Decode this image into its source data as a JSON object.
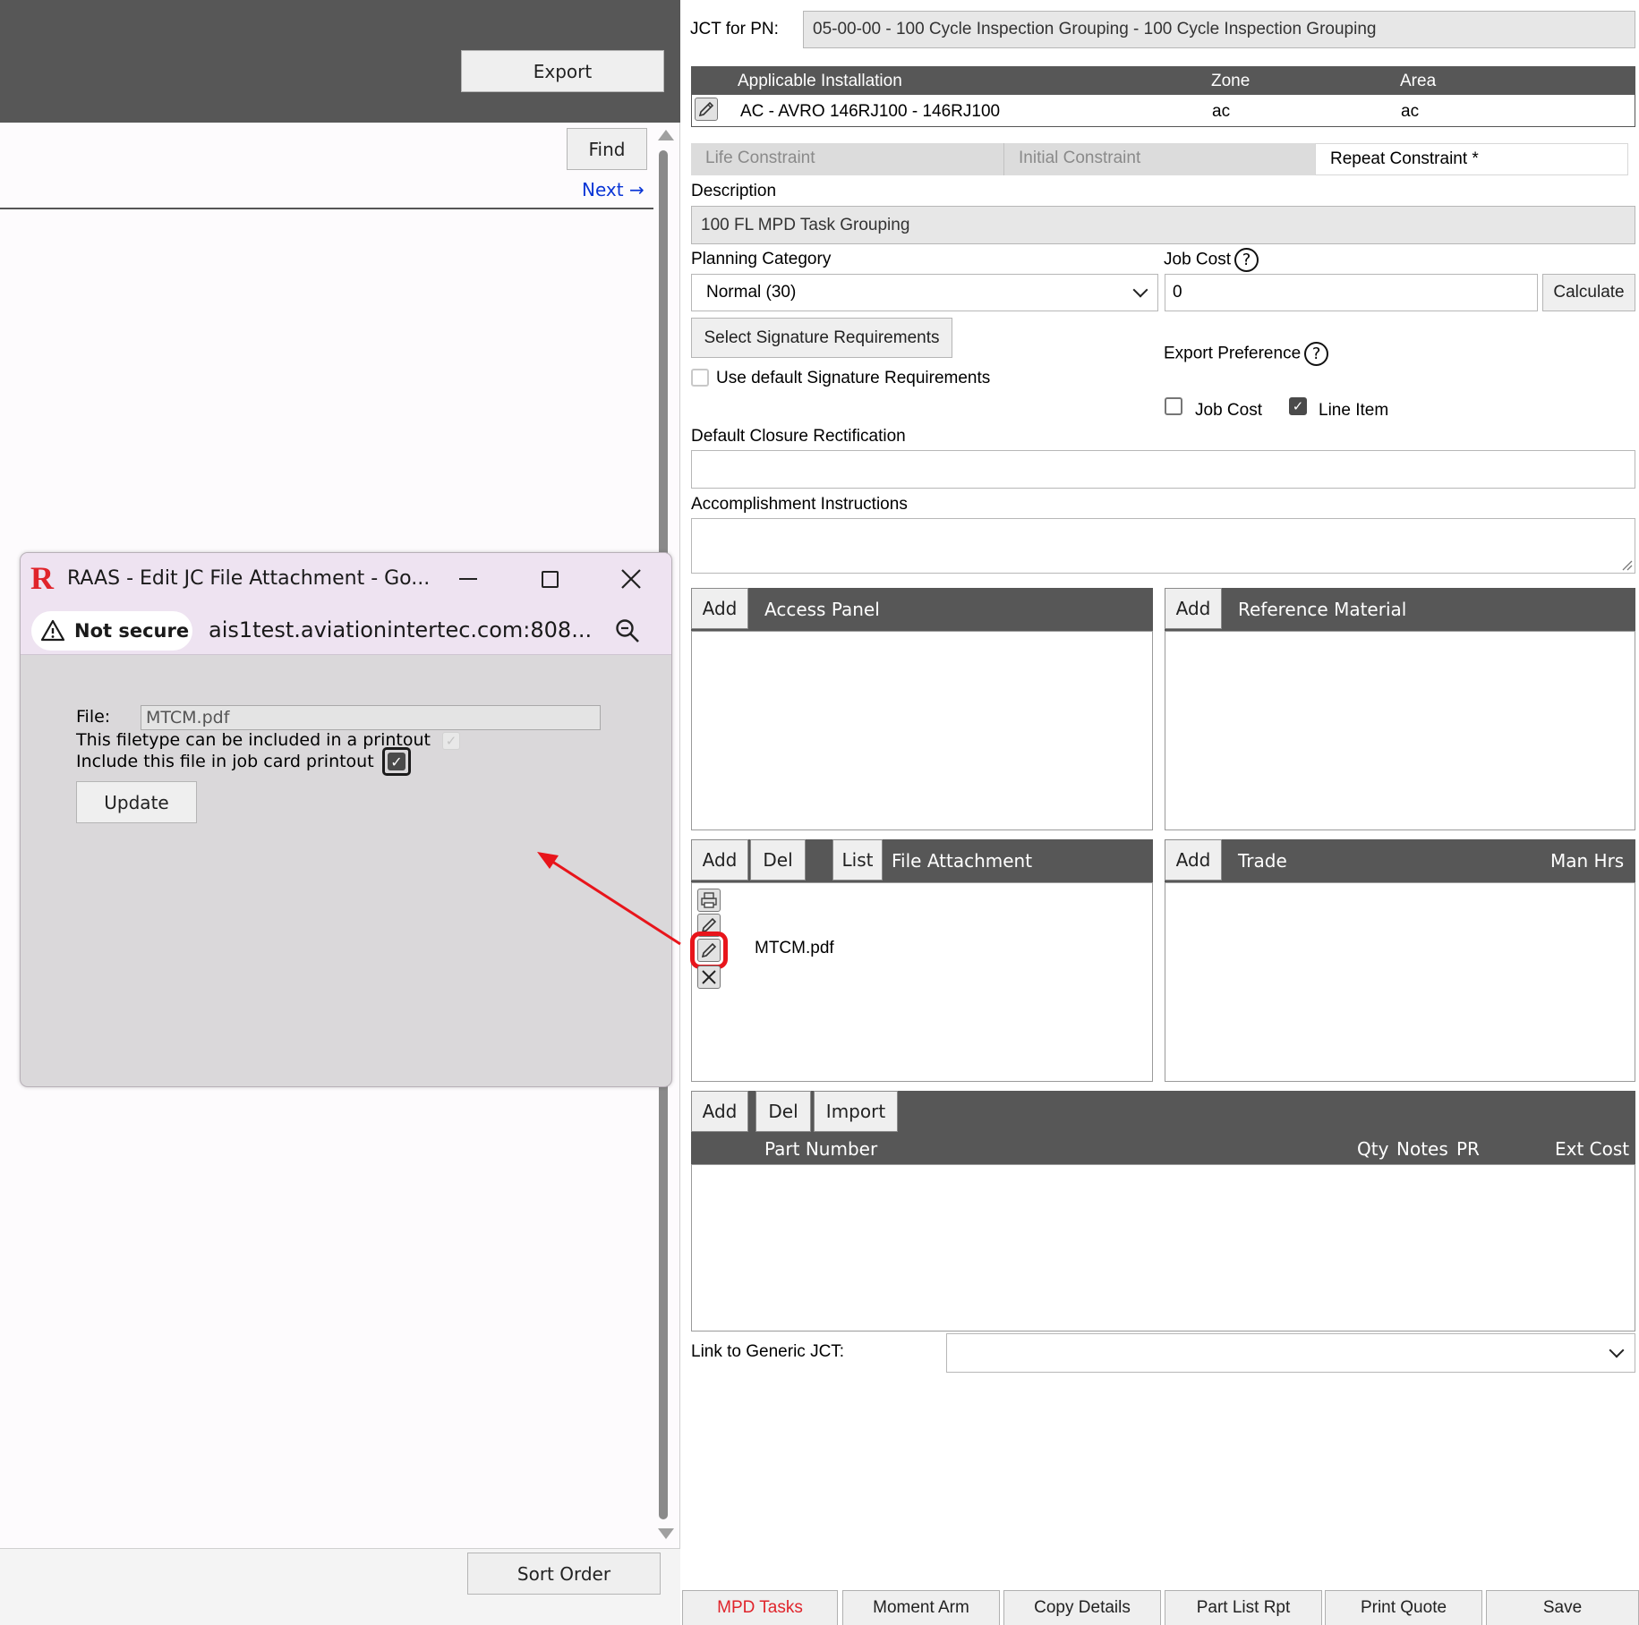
{
  "left": {
    "export_label": "Export",
    "find_label": "Find",
    "next_label": "Next →",
    "sort_label": "Sort Order"
  },
  "popup": {
    "logo": "R",
    "title": "RAAS - Edit JC File Attachment - Go...",
    "not_secure": "Not secure",
    "url": "ais1test.aviationintertec.com:808...",
    "file_label": "File:",
    "file_value": "MTCM.pdf",
    "printable_label": "This filetype can be included in a printout",
    "include_label": "Include this file in job card printout",
    "update_label": "Update"
  },
  "header": {
    "jct_label": "JCT for PN:",
    "jct_value": "05-00-00 - 100 Cycle Inspection Grouping - 100 Cycle Inspection Grouping"
  },
  "installation": {
    "col_installation": "Applicable Installation",
    "col_zone": "Zone",
    "col_area": "Area",
    "row_installation": "AC - AVRO 146RJ100 - 146RJ100",
    "row_zone": "ac",
    "row_area": "ac"
  },
  "tabs": {
    "life": "Life Constraint",
    "initial": "Initial Constraint",
    "repeat": "Repeat Constraint *"
  },
  "form": {
    "description_label": "Description",
    "description_value": "100 FL MPD Task Grouping",
    "planning_label": "Planning Category",
    "planning_value": "Normal (30)",
    "jobcost_label": "Job Cost",
    "jobcost_value": "0",
    "calculate_label": "Calculate",
    "sigreq_label": "Select Signature Requirements",
    "default_sig_label": "Use default Signature Requirements",
    "export_pref_label": "Export Preference",
    "export_jobcost_label": "Job Cost",
    "export_lineitem_label": "Line Item",
    "closure_label": "Default Closure Rectification",
    "accomplish_label": "Accomplishment Instructions",
    "help_glyph": "?",
    "check_glyph": "✓"
  },
  "panels": {
    "add": "Add",
    "del": "Del",
    "list": "List",
    "import": "Import",
    "access_panel": "Access Panel",
    "reference_material": "Reference Material",
    "file_attachment": "File Attachment",
    "file_name": "MTCM.pdf",
    "trade": "Trade",
    "man_hrs": "Man Hrs",
    "part_number": "Part Number",
    "qty": "Qty",
    "notes": "Notes",
    "pr": "PR",
    "ext_cost": "Ext Cost"
  },
  "generic": {
    "link_label": "Link to Generic JCT:"
  },
  "bottom_tabs": [
    "MPD Tasks",
    "Moment Arm",
    "Copy Details",
    "Part List Rpt",
    "Print Quote",
    "Save"
  ],
  "colors": {
    "dark_bar": "#575757",
    "accent_red": "#e0242b",
    "link_blue": "#0b36d6"
  }
}
